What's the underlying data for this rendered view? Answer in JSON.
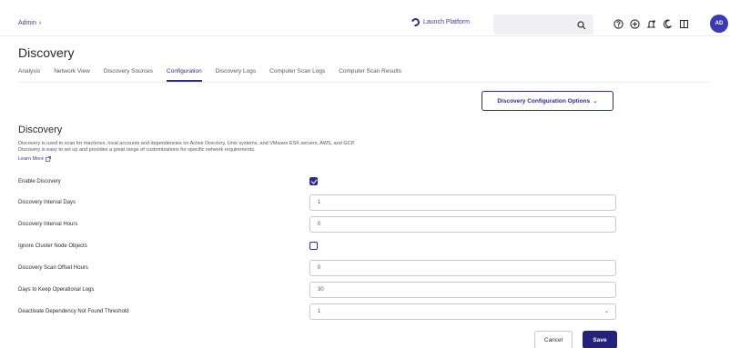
{
  "topbar": {
    "breadcrumb": "Admin",
    "launch_label": "Launch Platform",
    "search": {
      "value": "",
      "placeholder": ""
    },
    "avatar_initials": "AD"
  },
  "header": {
    "title": "Discovery",
    "tabs": [
      {
        "label": "Analysis",
        "active": false
      },
      {
        "label": "Network View",
        "active": false
      },
      {
        "label": "Discovery Sources",
        "active": false
      },
      {
        "label": "Configuration",
        "active": true
      },
      {
        "label": "Discovery Logs",
        "active": false
      },
      {
        "label": "Computer Scan Logs",
        "active": false
      },
      {
        "label": "Computer Scan Results",
        "active": false
      }
    ]
  },
  "options_button": "Discovery Configuration Options",
  "section": {
    "title": "Discovery",
    "description_line1": "Discovery is used to scan for machines, local accounts and dependencies on Active Directory, Unix systems, and VMware ESX servers, AWS, and GCP.",
    "description_line2": "Discovery is easy to set up and provides a great range of customizations for specific network requirements.",
    "learn_more": "Learn More"
  },
  "fields": {
    "enable_discovery": {
      "label": "Enable Discovery",
      "checked": true
    },
    "interval_days": {
      "label": "Discovery Interval Days",
      "value": "1"
    },
    "interval_hours": {
      "label": "Discovery Interval Hours",
      "value": "0"
    },
    "ignore_cluster": {
      "label": "Ignore Cluster Node Objects",
      "checked": false
    },
    "scan_offset": {
      "label": "Discovery Scan Offset Hours",
      "value": "0"
    },
    "keep_logs": {
      "label": "Days to Keep Operational Logs",
      "value": "30"
    },
    "deactivate_threshold": {
      "label": "Deactivate Dependency Not Found Threshold",
      "value": "1"
    }
  },
  "actions": {
    "cancel": "Cancel",
    "save": "Save"
  },
  "colors": {
    "accent": "#2d2b8f",
    "save_bg": "#24227a",
    "avatar": "#3a3ab8"
  }
}
